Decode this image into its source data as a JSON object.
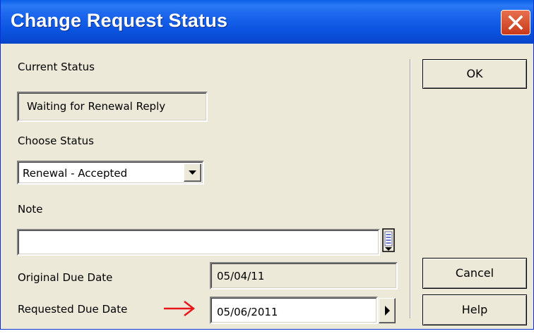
{
  "window": {
    "title": "Change Request Status"
  },
  "form": {
    "current_status_label": "Current Status",
    "current_status_value": "Waiting for Renewal Reply",
    "choose_status_label": "Choose Status",
    "choose_status_value": "Renewal - Accepted",
    "note_label": "Note",
    "note_value": "",
    "original_due_label": "Original Due Date",
    "original_due_value": "05/04/11",
    "requested_due_label": "Requested Due Date",
    "requested_due_value": "05/06/2011"
  },
  "buttons": {
    "ok": "OK",
    "cancel": "Cancel",
    "help": "Help"
  },
  "colors": {
    "title_bar": "#0a53e0",
    "dialog_bg": "#ece9d8",
    "annotation_arrow": "#e8171a",
    "close_button": "#d8532f"
  },
  "icons": [
    "close-icon",
    "dropdown-arrow-icon",
    "note-editor-icon",
    "date-picker-arrow-icon",
    "annotation-arrow-icon"
  ]
}
